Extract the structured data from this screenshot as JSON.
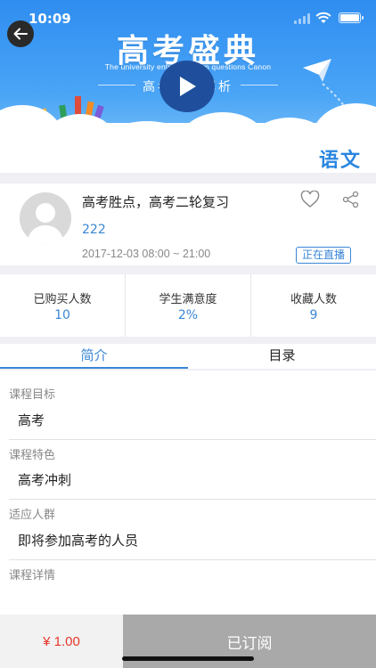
{
  "status_bar": {
    "time": "10:09"
  },
  "banner": {
    "title": "高考盛典",
    "subtitle_en": "The university entrance exam questions Canon",
    "subtitle": "高考试题解析",
    "subject": "语文"
  },
  "course": {
    "title": "高考胜点，高考二轮复习",
    "code": "222",
    "time": "2017-12-03 08:00 ~ 21:00",
    "live_badge": "正在直播"
  },
  "stats": [
    {
      "label": "已购买人数",
      "value": "10"
    },
    {
      "label": "学生满意度",
      "value": "2%"
    },
    {
      "label": "收藏人数",
      "value": "9"
    }
  ],
  "tabs": [
    {
      "label": "简介",
      "active": true
    },
    {
      "label": "目录",
      "active": false
    }
  ],
  "sections": [
    {
      "label": "课程目标",
      "value": "高考"
    },
    {
      "label": "课程特色",
      "value": "高考冲刺"
    },
    {
      "label": "适应人群",
      "value": "即将参加高考的人员"
    },
    {
      "label": "课程详情",
      "value": ""
    }
  ],
  "bottom": {
    "price": "¥ 1.00",
    "subscribe_label": "已订阅"
  },
  "colors": {
    "accent": "#3a86d6",
    "banner_blue": "#2f8df0",
    "price_red": "#e8362a",
    "disabled_gray": "#a9a9a9"
  },
  "icons": [
    "back-arrow-icon",
    "play-icon",
    "heart-icon",
    "share-icon",
    "avatar-placeholder-icon",
    "paper-plane-icon",
    "pencils-icon"
  ]
}
